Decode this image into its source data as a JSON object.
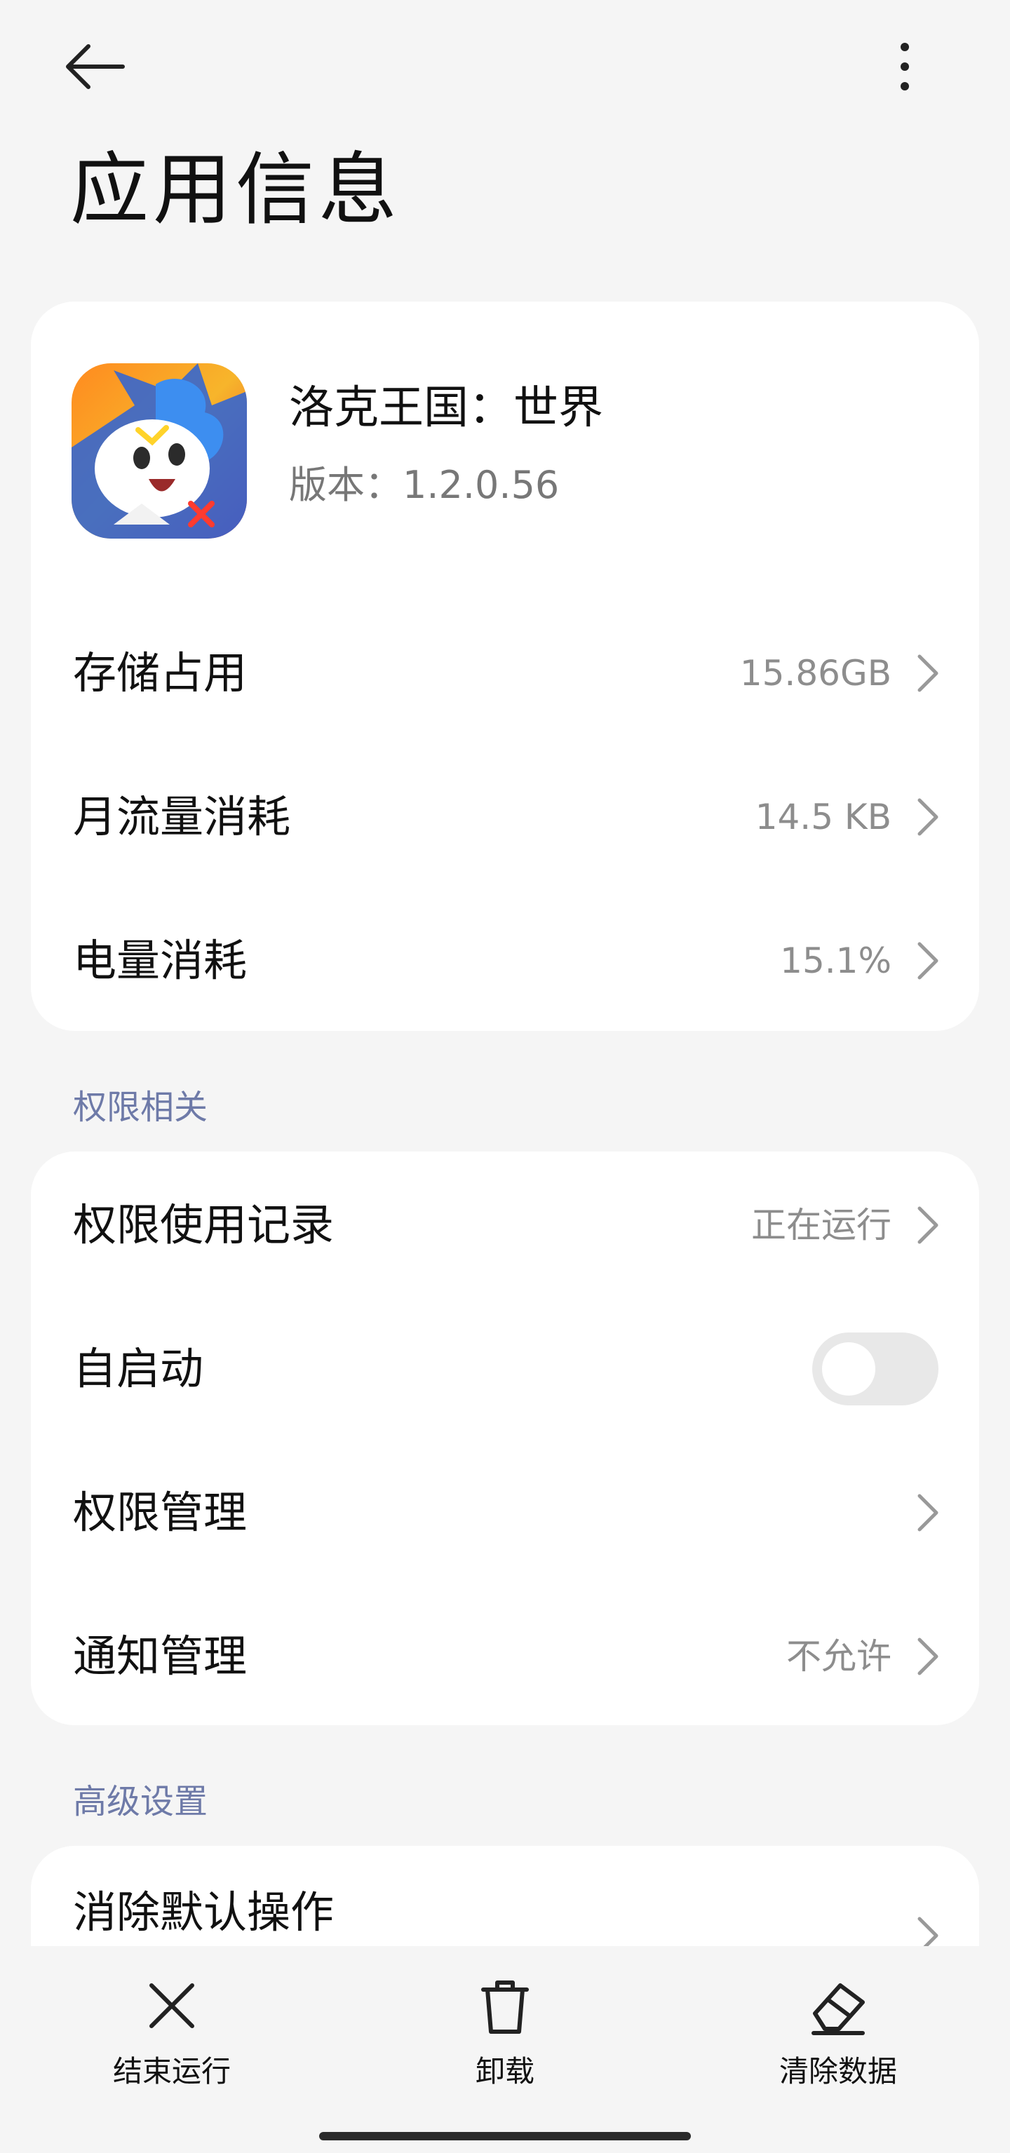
{
  "header": {
    "title": "应用信息",
    "back_icon": "back-arrow-icon",
    "more_icon": "more-vertical-icon"
  },
  "app": {
    "name": "洛克王国：世界",
    "version": "版本：1.2.0.56",
    "icon": "app-icon-roco-kingdom"
  },
  "usage": [
    {
      "label": "存储占用",
      "value": "15.86GB"
    },
    {
      "label": "月流量消耗",
      "value": "14.5 KB"
    },
    {
      "label": "电量消耗",
      "value": "15.1%"
    }
  ],
  "permissions": {
    "section_title": "权限相关",
    "items": [
      {
        "label": "权限使用记录",
        "value": "正在运行"
      },
      {
        "label": "自启动",
        "toggle": false
      },
      {
        "label": "权限管理",
        "value": ""
      },
      {
        "label": "通知管理",
        "value": "不允许"
      }
    ]
  },
  "advanced": {
    "section_title": "高级设置",
    "items": [
      {
        "label": "消除默认操作"
      }
    ]
  },
  "actions": [
    {
      "label": "结束运行",
      "icon": "close-icon"
    },
    {
      "label": "卸载",
      "icon": "trash-icon"
    },
    {
      "label": "清除数据",
      "icon": "eraser-icon"
    }
  ],
  "colors": {
    "section_title": "#6e7aa8",
    "secondary_text": "#8d8d8d",
    "background": "#f5f5f5",
    "card": "#ffffff"
  }
}
